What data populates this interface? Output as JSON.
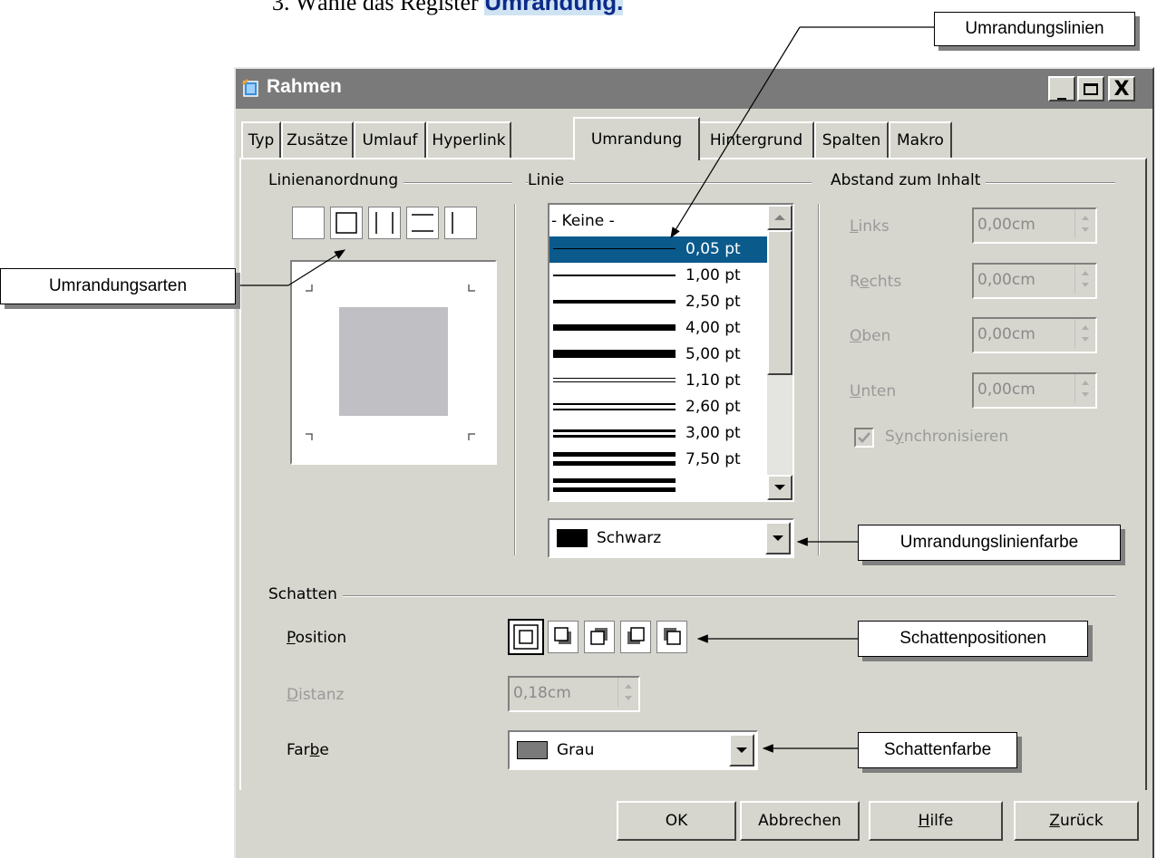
{
  "doc_step": {
    "prefix": "3. Wähle das Register ",
    "highlight": "Umrandung."
  },
  "callouts": {
    "umrandungslinien": "Umrandungslinien",
    "umrandungsarten": "Umrandungsarten",
    "umrandungslinienfarbe": "Umrandungslinienfarbe",
    "schattenpositionen": "Schattenpositionen",
    "schattenfarbe": "Schattenfarbe"
  },
  "window": {
    "title": "Rahmen",
    "minimize_glyph": "_",
    "maximize_glyph": "□",
    "close_glyph": "X"
  },
  "tabs": [
    {
      "label": "Typ"
    },
    {
      "label": "Zusätze"
    },
    {
      "label": "Umlauf"
    },
    {
      "label": "Hyperlink"
    },
    {
      "label": "Umrandung"
    },
    {
      "label": "Hintergrund"
    },
    {
      "label": "Spalten"
    },
    {
      "label": "Makro"
    }
  ],
  "active_tab": "Umrandung",
  "linienanordnung": {
    "label": "Linienanordnung"
  },
  "linie": {
    "label": "Linie",
    "items": [
      {
        "label": "- Keine -"
      },
      {
        "label": "0,05 pt",
        "selected": true
      },
      {
        "label": "1,00 pt"
      },
      {
        "label": "2,50 pt"
      },
      {
        "label": "4,00 pt"
      },
      {
        "label": "5,00 pt"
      },
      {
        "label": "1,10 pt"
      },
      {
        "label": "2,60 pt"
      },
      {
        "label": "3,00 pt"
      },
      {
        "label": "7,50 pt"
      }
    ],
    "color_value": "Schwarz",
    "color_swatch": "#000000"
  },
  "abstand": {
    "label": "Abstand zum Inhalt",
    "links": {
      "label_pre": "",
      "label_key": "L",
      "label_post": "inks",
      "value": "0,00cm"
    },
    "rechts": {
      "label_pre": "R",
      "label_key": "e",
      "label_post": "chts",
      "value": "0,00cm"
    },
    "oben": {
      "label_pre": "",
      "label_key": "O",
      "label_post": "ben",
      "value": "0,00cm"
    },
    "unten": {
      "label_pre": "",
      "label_key": "U",
      "label_post": "nten",
      "value": "0,00cm"
    },
    "sync": {
      "label_pre": "S",
      "label_key": "y",
      "label_post": "nchronisieren",
      "checked": true
    }
  },
  "schatten": {
    "label": "Schatten",
    "position": {
      "label_key": "P",
      "label_post": "osition"
    },
    "distanz": {
      "label_key": "D",
      "label_post": "istanz",
      "value": "0,18cm"
    },
    "farbe": {
      "label_pre": "Far",
      "label_key": "b",
      "label_post": "e",
      "value": "Grau",
      "swatch": "#7a7a7a"
    }
  },
  "buttons": {
    "ok": "OK",
    "cancel": "Abbrechen",
    "help_key": "H",
    "help_post": "ilfe",
    "back_key": "Z",
    "back_post": "urück"
  },
  "colors": {
    "selection": "#0a5a8c",
    "dialog_bg": "#d6d6ce",
    "titlebar": "#7a7a7a",
    "preview_fill": "#c0c0c4"
  }
}
